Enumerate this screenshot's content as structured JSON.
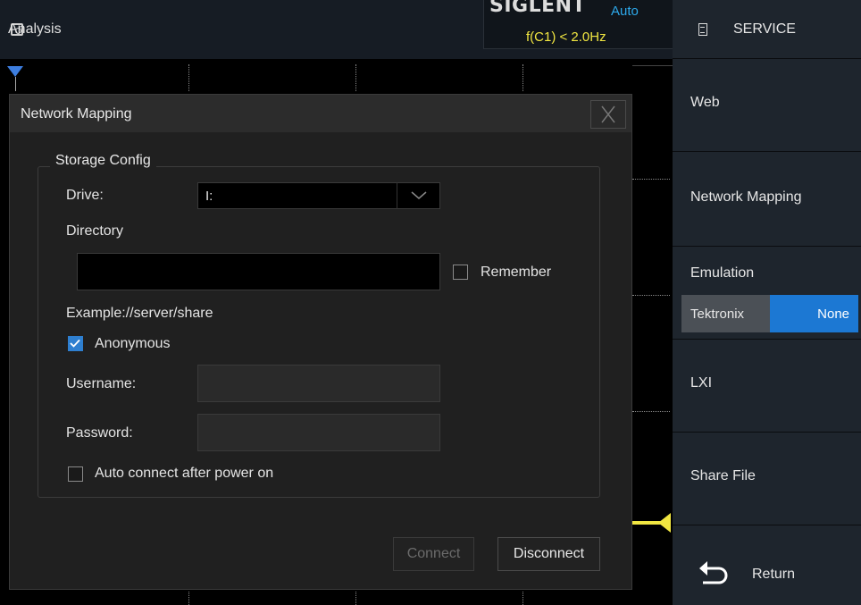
{
  "topbar": {
    "analysis_label": "Analysis",
    "brand": "SIGLENT",
    "mode": "Auto",
    "trigger_readout": "f(C1) < 2.0Hz"
  },
  "right_menu": {
    "title": "SERVICE",
    "items": [
      {
        "label": "Web"
      },
      {
        "label": "Network Mapping"
      },
      {
        "label": "Emulation"
      },
      {
        "label": "LXI"
      },
      {
        "label": "Share File"
      },
      {
        "label": "Return"
      }
    ],
    "emulation_options": [
      "Tektronix",
      "None"
    ],
    "emulation_selected": "None"
  },
  "dialog": {
    "title": "Network Mapping",
    "close_glyph": "X",
    "group_title": "Storage Config",
    "drive_label": "Drive:",
    "drive_value": "I:",
    "directory_label": "Directory",
    "directory_value": "",
    "remember_label": "Remember",
    "remember_checked": false,
    "example_text": "Example://server/share",
    "anonymous_label": "Anonymous",
    "anonymous_checked": true,
    "username_label": "Username:",
    "username_value": "",
    "password_label": "Password:",
    "password_value": "",
    "autoconnect_label": "Auto connect after power on",
    "autoconnect_checked": false,
    "connect_label": "Connect",
    "disconnect_label": "Disconnect"
  },
  "colors": {
    "accent_blue": "#1c78d3",
    "trigger_yellow": "#f1e641",
    "mode_blue": "#2da8ea"
  },
  "icons": [
    "analysis-icon",
    "document-icon",
    "close-icon",
    "chevron-down-icon",
    "check-icon",
    "return-icon",
    "trigger-marker-icon"
  ]
}
